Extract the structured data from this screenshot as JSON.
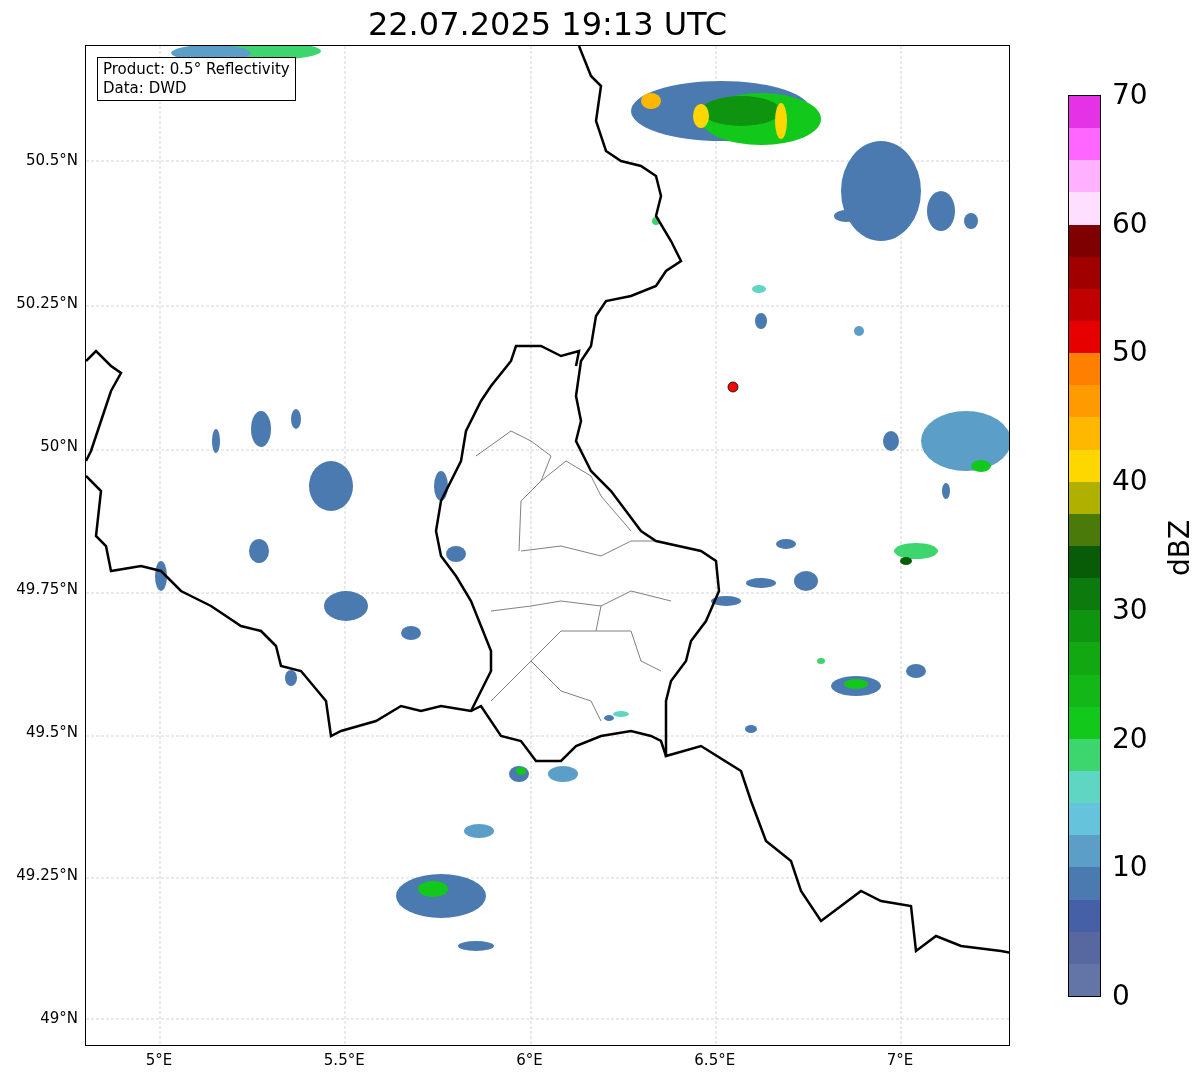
{
  "title": "22.07.2025 19:13 UTC",
  "info_box": {
    "lines": [
      "Product: 0.5° Reflectivity",
      "Data: DWD"
    ]
  },
  "y_axis": {
    "ticks": [
      "50.5°N",
      "50.25°N",
      "50°N",
      "49.75°N",
      "49.5°N",
      "49.25°N",
      "49°N"
    ]
  },
  "x_axis": {
    "ticks": [
      "5°E",
      "5.5°E",
      "6°E",
      "6.5°E",
      "7°E"
    ]
  },
  "colorbar": {
    "label": "dBZ",
    "ticks": [
      "70",
      "60",
      "50",
      "40",
      "30",
      "20",
      "10",
      "0"
    ],
    "segments": [
      {
        "color": "#6374a6"
      },
      {
        "color": "#5767a0"
      },
      {
        "color": "#4560a6"
      },
      {
        "color": "#4a7ab0"
      },
      {
        "color": "#5b9ec8"
      },
      {
        "color": "#66c3dc"
      },
      {
        "color": "#5fd6c4"
      },
      {
        "color": "#3dd66e"
      },
      {
        "color": "#12c81a"
      },
      {
        "color": "#13b818"
      },
      {
        "color": "#11a812"
      },
      {
        "color": "#0f940f"
      },
      {
        "color": "#0c7a0c"
      },
      {
        "color": "#085c08"
      },
      {
        "color": "#4a7a0a"
      },
      {
        "color": "#b0b000"
      },
      {
        "color": "#ffd700"
      },
      {
        "color": "#ffb800"
      },
      {
        "color": "#ff9a00"
      },
      {
        "color": "#ff7f00"
      },
      {
        "color": "#e60000"
      },
      {
        "color": "#c00000"
      },
      {
        "color": "#a00000"
      },
      {
        "color": "#7f0000"
      },
      {
        "color": "#ffdfff"
      },
      {
        "color": "#ffb0ff"
      },
      {
        "color": "#ff66ff"
      },
      {
        "color": "#e632e6"
      }
    ]
  }
}
